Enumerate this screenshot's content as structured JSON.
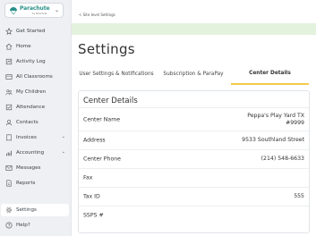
{
  "sidebar": {
    "logo": {
      "name": "Parachute",
      "sub": "by Parachute"
    },
    "items": [
      {
        "label": "Get Started",
        "icon": "star-icon"
      },
      {
        "label": "Home",
        "icon": "home-icon"
      },
      {
        "label": "Activity Log",
        "icon": "activity-log-icon"
      },
      {
        "label": "All Classrooms",
        "icon": "classrooms-icon"
      },
      {
        "label": "My Children",
        "icon": "children-icon"
      },
      {
        "label": "Attendance",
        "icon": "attendance-icon"
      },
      {
        "label": "Contacts",
        "icon": "contacts-icon"
      },
      {
        "label": "Invoices",
        "icon": "invoices-icon"
      },
      {
        "label": "Accounting",
        "icon": "accounting-icon"
      },
      {
        "label": "Messages",
        "icon": "messages-icon"
      },
      {
        "label": "Reports",
        "icon": "reports-icon"
      },
      {
        "label": "Settings",
        "icon": "gear-icon"
      },
      {
        "label": "Help?",
        "icon": "help-icon"
      }
    ]
  },
  "breadcrumb": {
    "text": "< Site level Settings"
  },
  "page": {
    "title": "Settings"
  },
  "tabs": [
    {
      "label": "User Settings & Notifications"
    },
    {
      "label": "Subscription & ParaPay"
    },
    {
      "label": "Center Details"
    }
  ],
  "center": {
    "title": "Center Details",
    "rows": [
      {
        "label": "Center Name",
        "value": "Peppa's Play Yard TX #9999"
      },
      {
        "label": "Address",
        "value": "9533 Southland Street"
      },
      {
        "label": "Center Phone",
        "value": "(214) 548-6633"
      },
      {
        "label": "Fax",
        "value": ""
      },
      {
        "label": "Tax ID",
        "value": "555"
      },
      {
        "label": "SSPS #",
        "value": ""
      }
    ]
  },
  "colors": {
    "accent": "#f2c94c",
    "banner": "#e3f2dd",
    "brand": "#2a8f8a"
  }
}
